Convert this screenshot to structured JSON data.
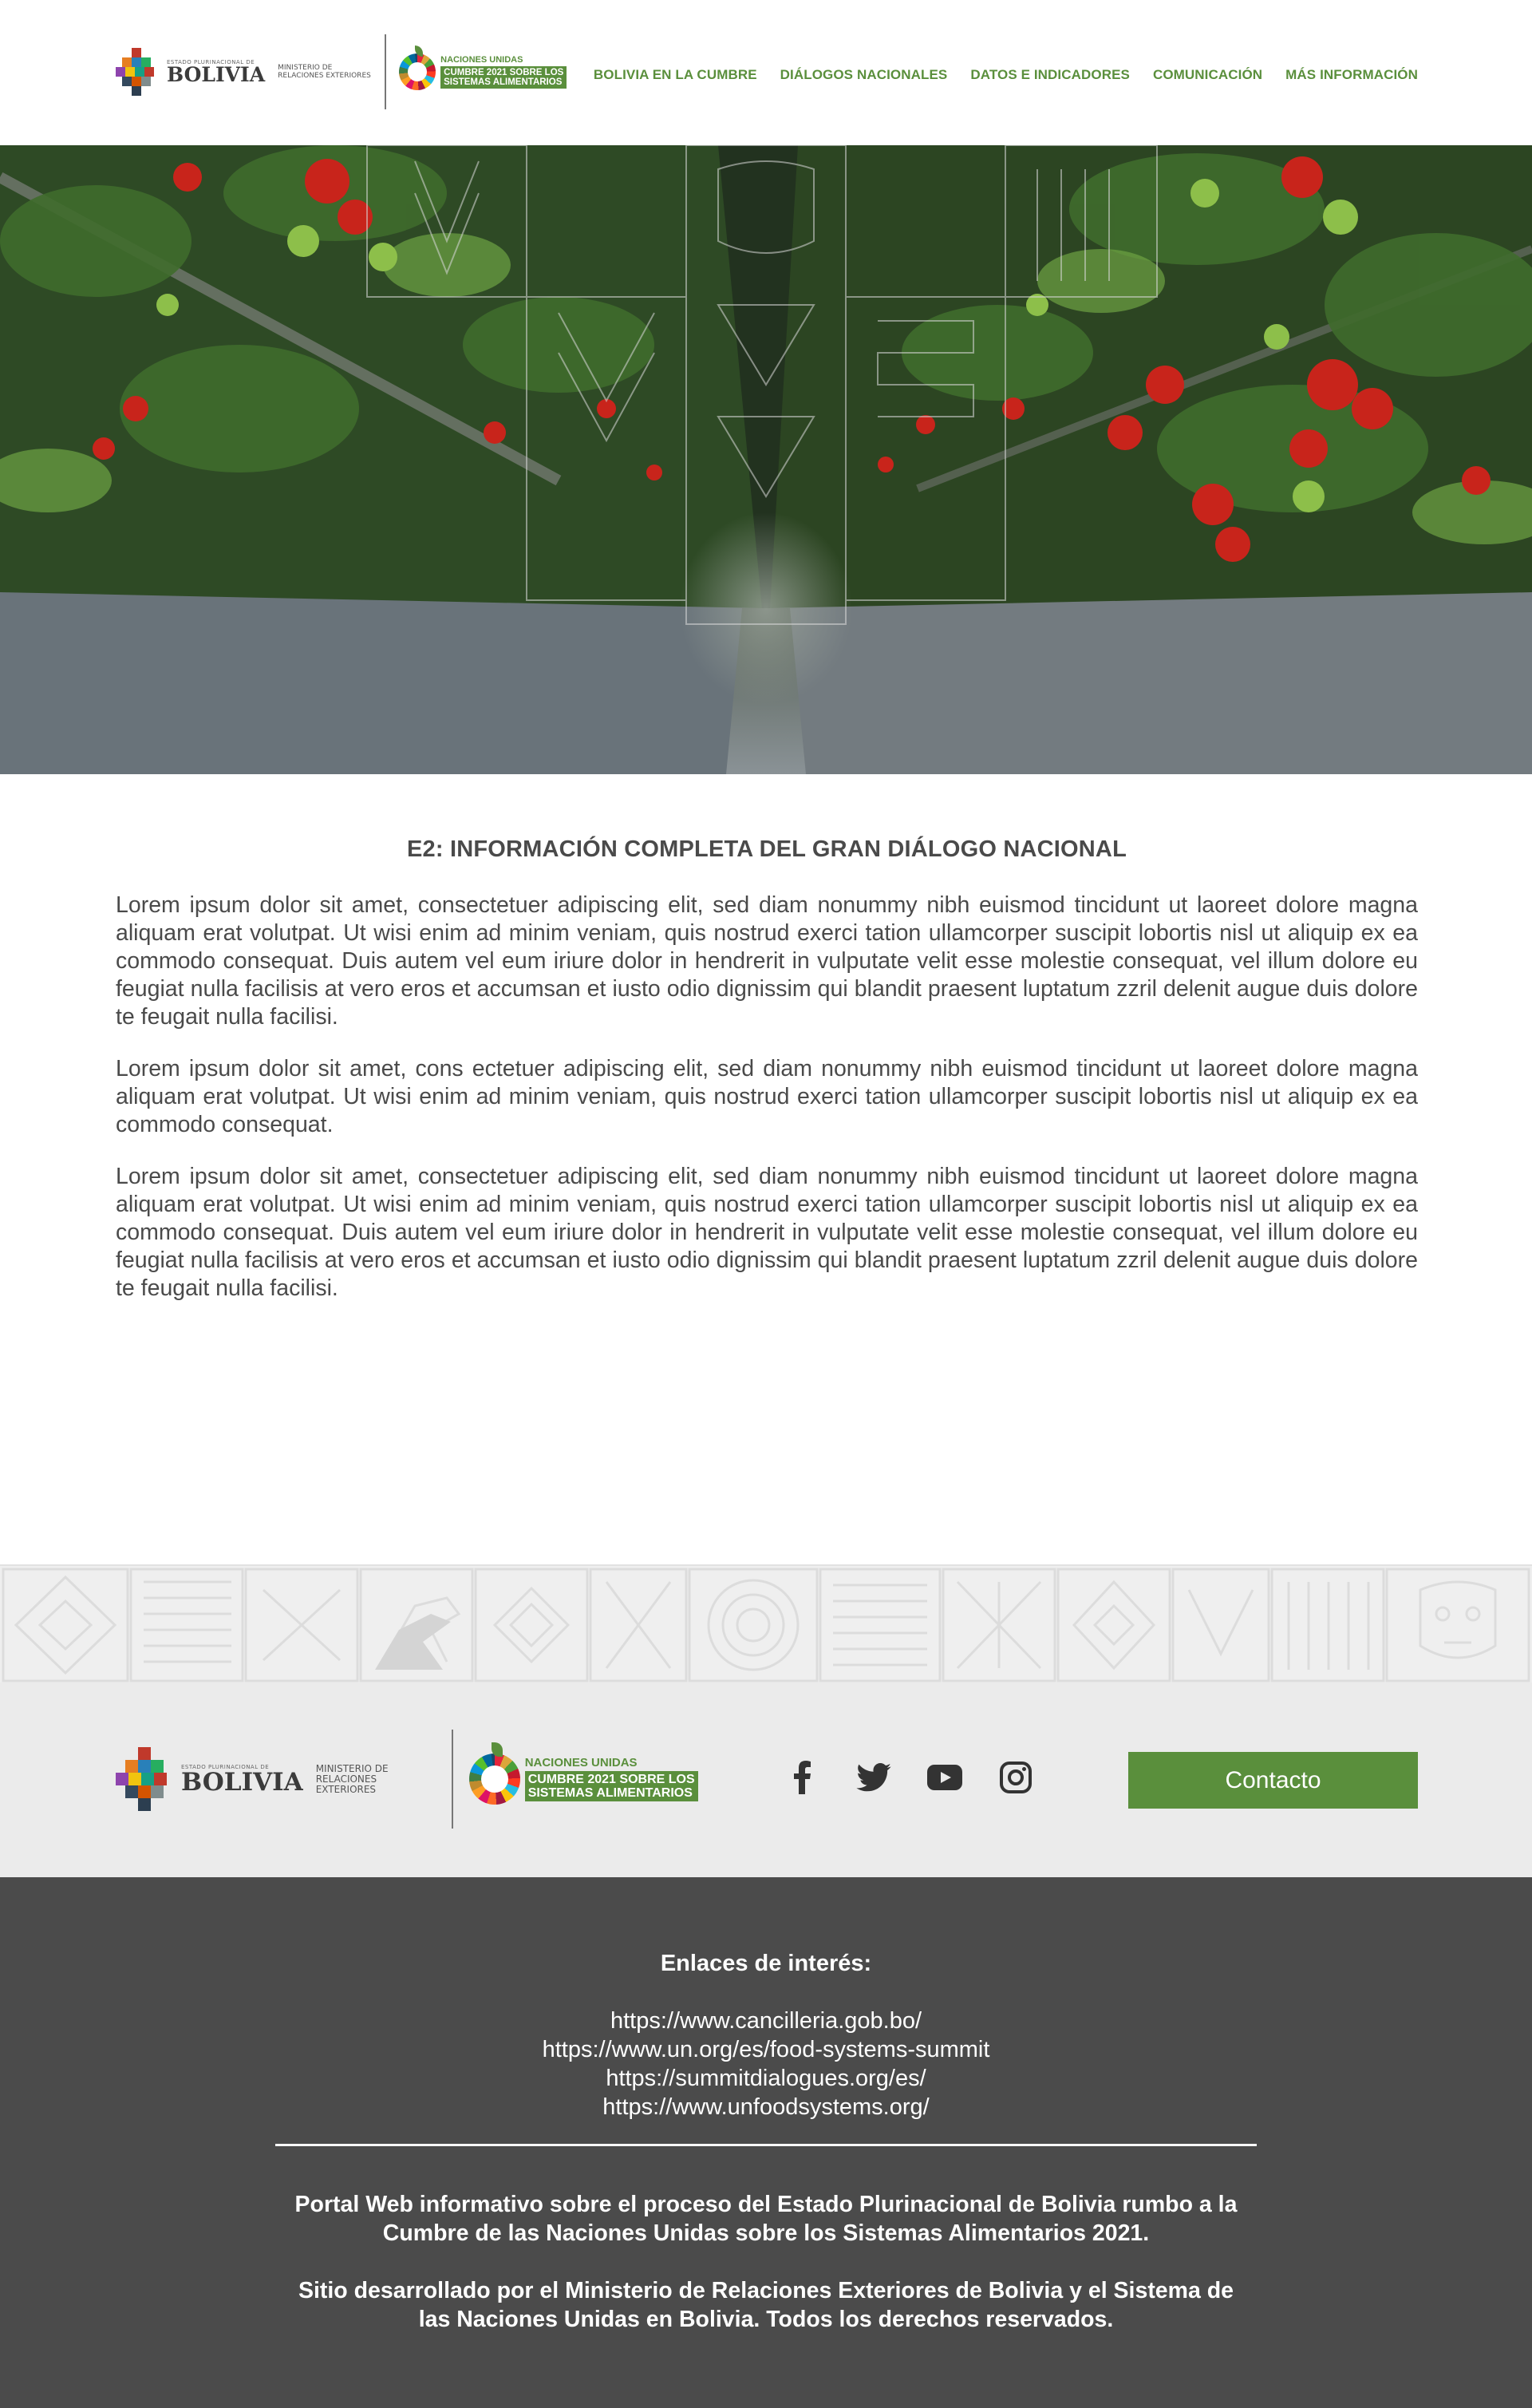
{
  "header": {
    "logo_bolivia": {
      "small": "ESTADO PLURINACIONAL DE",
      "name": "BOLIVIA",
      "ministry": "MINISTERIO DE RELACIONES EXTERIORES"
    },
    "logo_un": {
      "line1": "NACIONES UNIDAS",
      "line2": "CUMBRE 2021 SOBRE LOS",
      "line3": "SISTEMAS ALIMENTARIOS"
    },
    "nav": [
      {
        "label": "BOLIVIA EN LA CUMBRE"
      },
      {
        "label": "DIÁLOGOS NACIONALES"
      },
      {
        "label": "DATOS E INDICADORES"
      },
      {
        "label": "COMUNICACIÓN"
      },
      {
        "label": "MÁS INFORMACIÓN"
      }
    ]
  },
  "hero": {
    "image": "tomato-greenhouse-photo-with-andean-pattern-overlay"
  },
  "main": {
    "title": "E2: INFORMACIÓN COMPLETA DEL GRAN DIÁLOGO NACIONAL",
    "paragraphs": [
      "Lorem ipsum dolor sit amet, consectetuer adipiscing elit, sed diam nonummy nibh euismod tincidunt ut laoreet dolore magna aliquam erat volutpat. Ut wisi enim ad minim veniam, quis nostrud exerci tation ullamcorper suscipit lobortis nisl ut aliquip ex ea commodo consequat. Duis autem vel eum iriure dolor in hendrerit in vulputate velit esse molestie consequat, vel illum dolore eu feugiat nulla facilisis at vero eros et accumsan et iusto odio dignissim qui blandit praesent luptatum zzril delenit augue duis dolore te feugait nulla facilisi.",
      "Lorem ipsum dolor sit amet, cons ectetuer adipiscing elit, sed diam nonummy nibh euismod tincidunt ut laoreet dolore magna aliquam erat volutpat. Ut wisi enim ad minim veniam, quis nostrud exerci tation ullamcorper suscipit lobortis nisl ut aliquip ex ea commodo consequat.",
      "Lorem ipsum dolor sit amet, consectetuer adipiscing elit, sed diam nonummy nibh euismod tincidunt ut laoreet dolore magna aliquam erat volutpat. Ut wisi enim ad minim veniam, quis nostrud exerci tation ullamcorper suscipit lobortis nisl ut aliquip ex ea commodo consequat. Duis autem vel eum iriure dolor in hendrerit in vulputate velit esse molestie consequat, vel illum dolore eu feugiat nulla facilisis at vero eros et accumsan et iusto odio dignissim qui blandit praesent luptatum zzril delenit augue duis dolore te feugait nulla facilisi."
    ]
  },
  "footer": {
    "socials": [
      {
        "icon": "facebook-icon"
      },
      {
        "icon": "twitter-icon"
      },
      {
        "icon": "youtube-icon"
      },
      {
        "icon": "instagram-icon"
      }
    ],
    "contact_label": "Contacto",
    "links_title": "Enlaces de interés:",
    "links": [
      "https://www.cancilleria.gob.bo/",
      "https://www.un.org/es/food-systems-summit",
      "https://summitdialogues.org/es/",
      "https://www.unfoodsystems.org/"
    ],
    "note1": "Portal Web informativo sobre el proceso del Estado Plurinacional de Bolivia rumbo a la Cumbre de las Naciones Unidas sobre los Sistemas Alimentarios 2021.",
    "note2": "Sitio desarrollado por el Ministerio de Relaciones Exteriores de Bolivia y el Sistema de las Naciones Unidas en Bolivia. Todos los derechos reservados."
  },
  "colors": {
    "brand_green": "#5a8f3c",
    "footer_dark": "#4b4b4b",
    "footer_light": "#ebebeb",
    "text": "#4a4a4a"
  }
}
